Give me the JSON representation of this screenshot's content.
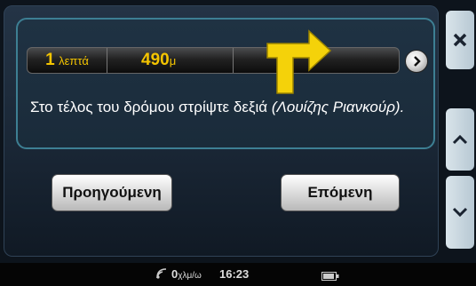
{
  "navigation": {
    "time_value": "1",
    "time_unit": "λεπτά",
    "distance_value": "490",
    "distance_unit": "μ",
    "instruction_text": "Στο τέλος του δρόμου στρίψτε δεξιά",
    "instruction_street": "(Λουίζης Ριανκούρ)."
  },
  "buttons": {
    "previous_label": "Προηγούμενη",
    "next_label": "Επόμενη"
  },
  "side_panel": {
    "close_icon": "close-icon",
    "up_icon": "chevron-up-icon",
    "down_icon": "chevron-down-icon"
  },
  "status": {
    "speed_value": "0",
    "speed_unit": "χλμ/ω",
    "clock": "16:23",
    "battery_icon": "battery-icon",
    "gps_icon": "gps-signal-icon"
  },
  "colors": {
    "accent": "#f4c400",
    "panel_border": "#3d7f93",
    "background": "#1a2736"
  }
}
